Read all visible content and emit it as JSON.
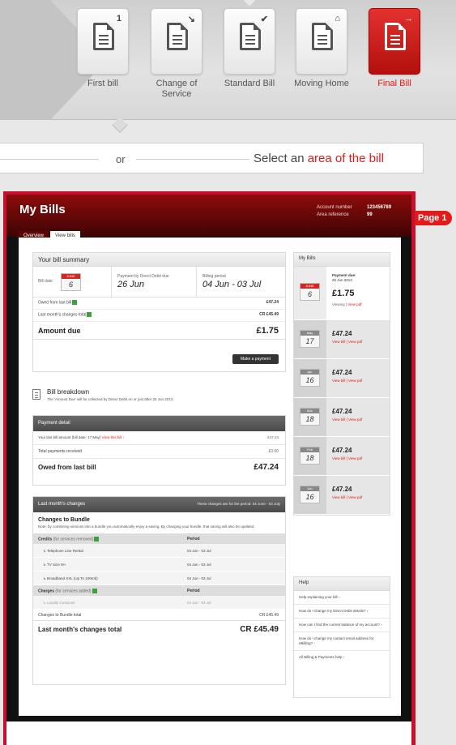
{
  "bill_types": [
    {
      "label": "First bill",
      "badge": "1",
      "active": false
    },
    {
      "label": "Change of Service",
      "badge": "↘",
      "active": false
    },
    {
      "label": "Standard Bill",
      "badge": "✔",
      "active": false
    },
    {
      "label": "Moving Home",
      "badge": "⌂",
      "active": false
    },
    {
      "label": "Final Bill",
      "badge": "→",
      "active": true
    }
  ],
  "selector": {
    "or_text": "or",
    "area_prefix": "Select an ",
    "area_highlight": "area of the bill"
  },
  "page_badge": "Page 1",
  "app": {
    "title": "My Bills",
    "account_number_label": "Account number",
    "account_number": "123456789",
    "area_reference_label": "Area reference",
    "area_reference": "99",
    "tabs": [
      "Overview",
      "View bills"
    ],
    "active_tab": "View bills"
  },
  "summary": {
    "title": "Your bill summary",
    "bill_date_label": "Bill date",
    "bill_date_month": "JUNE",
    "bill_date_day": "6",
    "payment_label": "Payment by Direct Debit due",
    "payment_date": "26 Jun",
    "period_label": "Billing period",
    "period": "04 Jun - 03 Jul",
    "owed_label": "Owed from last bill",
    "owed_value": "£47.24",
    "changes_label": "Last month's changes total",
    "changes_value": "CR £45.49",
    "amount_due_label": "Amount due",
    "amount_due_value": "£1.75",
    "make_payment": "Make a payment"
  },
  "breakdown": {
    "title": "Bill breakdown",
    "subtitle": "The 'Amount Due' will be collected by Direct Debit on or just after 26 Jun 2013."
  },
  "payment_detail": {
    "title": "Payment detail",
    "last_bill_text": "Your last bill amount (bill date: 17 May)",
    "view_this_bill": "View this bill ›",
    "last_bill_value": "£47.24",
    "payments_label": "Total payments received",
    "payments_value": "£0.00",
    "owed_label": "Owed from last bill",
    "owed_value": "£47.24"
  },
  "changes": {
    "title": "Last month's changes",
    "period_note": "These changes are for the period: 04 June - 03 July",
    "bundle_title": "Changes to Bundle",
    "bundle_note": "Note: by combining services into a bundle you automatically enjoy a saving. By changing your bundle, that saving will also be updated.",
    "credits_label": "Credits",
    "credits_sub": "(for services removed)",
    "period_col": "Period",
    "credits": [
      {
        "name": "Telephone Line Rental",
        "period": "04 Jun - 03 Jul"
      },
      {
        "name": "TV Size M+",
        "period": "04 Jun - 03 Jul"
      },
      {
        "name": "Broadband XXL (Up To 100mb)",
        "period": "04 Jun - 03 Jul"
      }
    ],
    "charges_label": "Charges",
    "charges_sub": "(for services added)",
    "charges": [
      {
        "name": "Loyalty Customer",
        "period": "04 Jun - 03 Jul"
      }
    ],
    "bundle_total_label": "Changes to Bundle total",
    "bundle_total_value": "CR £45.49",
    "total_label": "Last month's changes total",
    "total_value": "CR £45.49"
  },
  "my_bills": {
    "title": "My Bills",
    "current": {
      "month": "JUNE",
      "day": "6",
      "due_label": "Payment due:",
      "due_date": "26 Jun 2013",
      "amount": "£1.75",
      "viewing": "Viewing",
      "view_pdf": "View pdf"
    },
    "items": [
      {
        "month": "May",
        "day": "17",
        "amount": "£47.24"
      },
      {
        "month": "Apr",
        "day": "16",
        "amount": "£47.24"
      },
      {
        "month": "Mar",
        "day": "18",
        "amount": "£47.24"
      },
      {
        "month": "Feb",
        "day": "18",
        "amount": "£47.24"
      },
      {
        "month": "Jan",
        "day": "16",
        "amount": "£47.24"
      }
    ],
    "view_bill": "View bill",
    "view_pdf": "View pdf"
  },
  "help": {
    "title": "Help",
    "items": [
      "Help explaining your bill",
      "How do I change my Direct Debit details?",
      "How can I find the current balance of my account?",
      "How do I change my contact email address for eBilling?",
      "All Billing & Payments help"
    ]
  },
  "colors": {
    "brand_red": "#e31a1a",
    "header_dark": "#3d0404"
  }
}
